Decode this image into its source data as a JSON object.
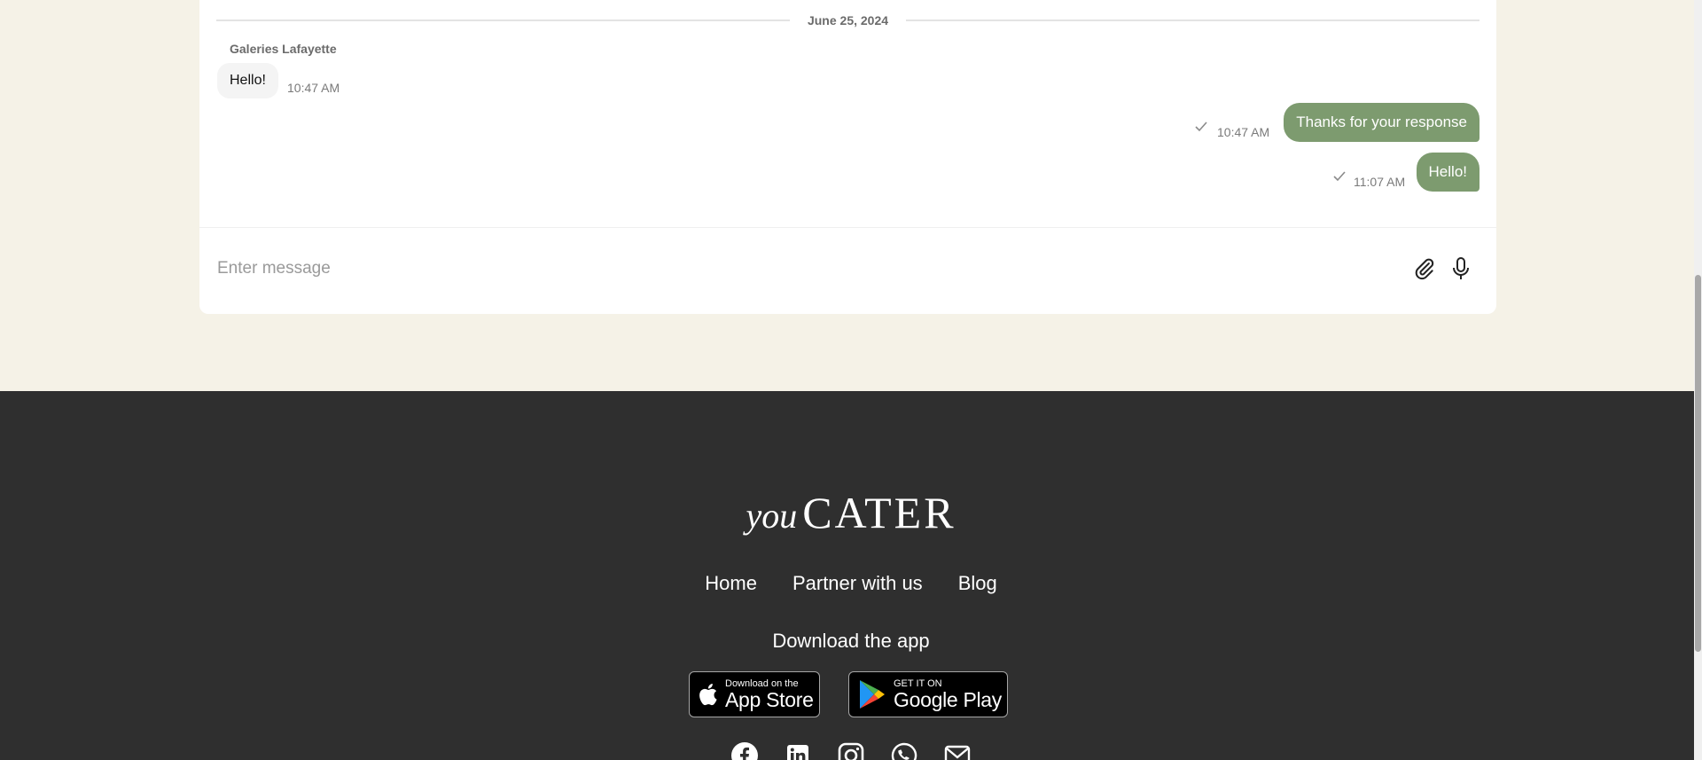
{
  "chat": {
    "date_separator": "June 25, 2024",
    "incoming": {
      "sender": "Galeries Lafayette",
      "text": "Hello!",
      "time": "10:47 AM"
    },
    "outgoing": [
      {
        "text": "Thanks for your response",
        "time": "10:47 AM"
      },
      {
        "text": "Hello!",
        "time": "11:07 AM"
      }
    ],
    "composer": {
      "placeholder": "Enter message"
    },
    "colors": {
      "outgoing_bubble": "#7d9b6f",
      "background": "#f5f2e7"
    }
  },
  "footer": {
    "logo": {
      "you": "you",
      "cater": "CATER"
    },
    "nav": [
      "Home",
      "Partner with us",
      "Blog"
    ],
    "download_title": "Download the app",
    "stores": {
      "apple": {
        "small": "Download on the",
        "big": "App Store"
      },
      "google": {
        "small": "GET IT ON",
        "big": "Google Play"
      }
    },
    "social_icons": [
      "facebook-icon",
      "linkedin-icon",
      "instagram-icon",
      "whatsapp-icon",
      "email-icon"
    ],
    "background": "#2f2f2f"
  }
}
